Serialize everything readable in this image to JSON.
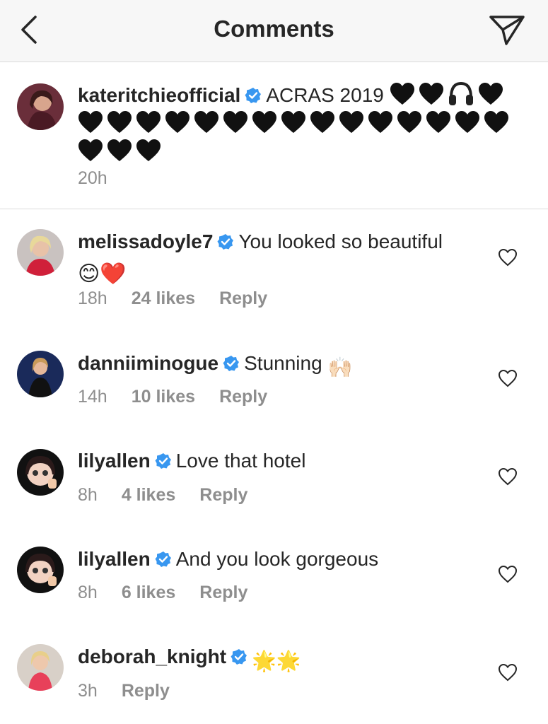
{
  "header": {
    "title": "Comments",
    "back_icon": "chevron-left-icon",
    "share_icon": "paper-plane-icon"
  },
  "caption": {
    "username": "kateritchieofficial",
    "text": "ACRAS 2019",
    "emoji_sequence": "🖤🖤🎧🖤🖤🖤🖤🖤🖤🖤🖤🖤🖤🖤🖤🖤🖤🖤🖤🖤🖤🖤",
    "time": "20h"
  },
  "comments": [
    {
      "username": "melissadoyle7",
      "text": "You looked so beautiful",
      "emojis": "😊❤️",
      "time": "18h",
      "likes": "24 likes",
      "reply": "Reply"
    },
    {
      "username": "danniiminogue",
      "text": "Stunning",
      "emojis": "🙌🏻",
      "time": "14h",
      "likes": "10 likes",
      "reply": "Reply"
    },
    {
      "username": "lilyallen",
      "text": "Love that hotel",
      "time": "8h",
      "likes": "4 likes",
      "reply": "Reply"
    },
    {
      "username": "lilyallen",
      "text": "And you look gorgeous",
      "time": "8h",
      "likes": "6 likes",
      "reply": "Reply"
    },
    {
      "username": "deborah_knight",
      "text": "",
      "emojis": "🌟🌟",
      "time": "3h",
      "reply": "Reply"
    }
  ],
  "colors": {
    "verified": "#3897f0",
    "meta": "#8e8e8e",
    "text": "#262626",
    "divider": "#dbdbdb"
  }
}
